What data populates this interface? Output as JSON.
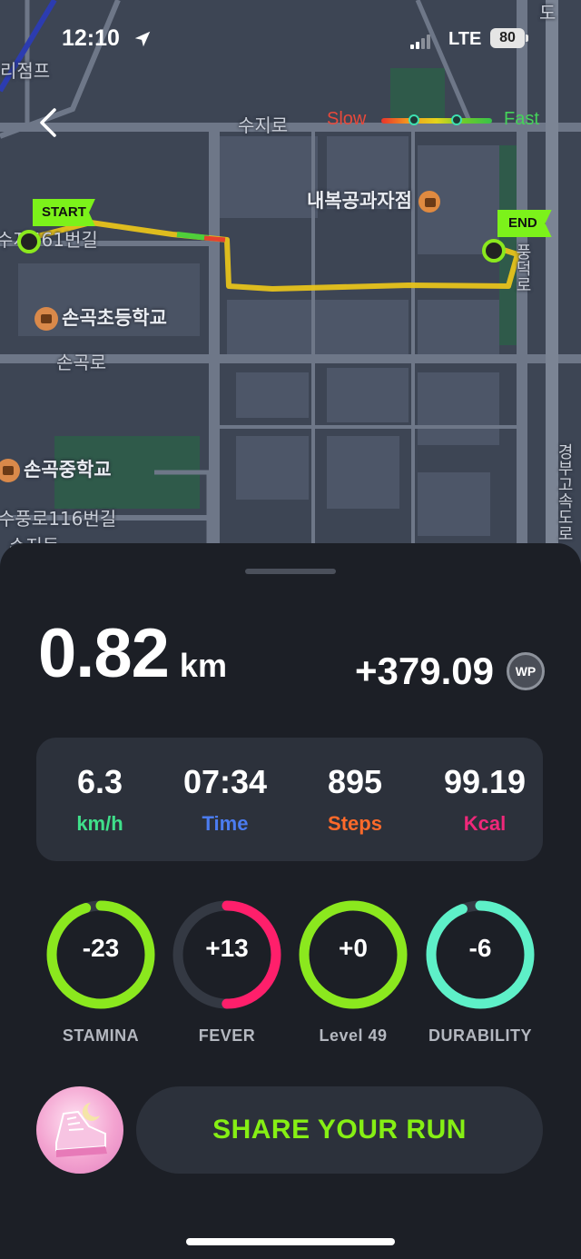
{
  "status_bar": {
    "time": "12:10",
    "network": "LTE",
    "battery": "80"
  },
  "map": {
    "legend": {
      "slow": "Slow",
      "fast": "Fast"
    },
    "start_label": "START",
    "end_label": "END",
    "labels": {
      "top_left": "리점프",
      "road_suji": "수지로",
      "bakery": "내복공과자점",
      "road_461": "수지461번길",
      "school_elem": "손곡초등학교",
      "road_songok": "손곡로",
      "school_mid": "손곡중학교",
      "road_116": "수풍로116번길",
      "road_right": "풍덕로",
      "highway": "경부고속도로",
      "bottom_left": "수지동",
      "top_right": "도"
    }
  },
  "run": {
    "distance": "0.82",
    "distance_unit": "km",
    "wp_value": "+379.09",
    "wp_badge": "WP"
  },
  "stats": [
    {
      "value": "6.3",
      "label": "km/h",
      "color": "#3fe08a"
    },
    {
      "value": "07:34",
      "label": "Time",
      "color": "#4b7cf0"
    },
    {
      "value": "895",
      "label": "Steps",
      "color": "#ff6a2a"
    },
    {
      "value": "99.19",
      "label": "Kcal",
      "color": "#f0287a"
    }
  ],
  "gauges": [
    {
      "value": "-23",
      "label": "STAMINA",
      "color": "#8be81e",
      "fill": 0.95
    },
    {
      "value": "+13",
      "label": "FEVER",
      "color": "#ff1f6b",
      "fill": 0.5
    },
    {
      "value": "+0",
      "label": "Level 49",
      "color": "#8be81e",
      "fill": 1.0
    },
    {
      "value": "-6",
      "label": "DURABILITY",
      "color": "#5ef0c8",
      "fill": 0.94
    }
  ],
  "share_button": "SHARE YOUR RUN"
}
